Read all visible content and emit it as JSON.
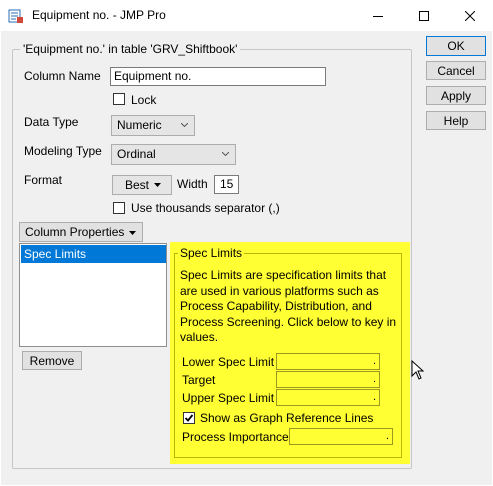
{
  "window": {
    "title": "Equipment no. - JMP Pro",
    "controls": [
      "minimize-icon",
      "maximize-icon",
      "close-icon"
    ]
  },
  "group": {
    "label": "'Equipment no.' in table 'GRV_Shiftbook'"
  },
  "column_name": {
    "label": "Column Name",
    "value": "Equipment no."
  },
  "lock": {
    "label": "Lock",
    "checked": false
  },
  "data_type": {
    "label": "Data Type",
    "value": "Numeric"
  },
  "modeling_type": {
    "label": "Modeling Type",
    "value": "Ordinal"
  },
  "format": {
    "label": "Format",
    "value": "Best",
    "width_label": "Width",
    "width_value": "15"
  },
  "thousands_separator": {
    "label": "Use thousands separator (,)",
    "checked": false
  },
  "column_properties": {
    "button_label": "Column Properties",
    "items": [
      "Spec Limits"
    ],
    "selected": "Spec Limits",
    "remove_label": "Remove"
  },
  "spec_limits": {
    "title": "Spec Limits",
    "description": "Spec Limits are specification limits that are used in various platforms such as Process Capability, Distribution, and Process Screening. Click below to key in values.",
    "lower_label": "Lower Spec Limit",
    "lower_value": ".",
    "target_label": "Target",
    "target_value": ".",
    "upper_label": "Upper Spec Limit",
    "upper_value": ".",
    "graph_ref_label": "Show as Graph Reference Lines",
    "graph_ref_checked": true,
    "importance_label": "Process Importance",
    "importance_value": "."
  },
  "buttons": {
    "ok": "OK",
    "cancel": "Cancel",
    "apply": "Apply",
    "help": "Help"
  },
  "colors": {
    "highlight": "#ffff33",
    "selection": "#0078d7"
  }
}
